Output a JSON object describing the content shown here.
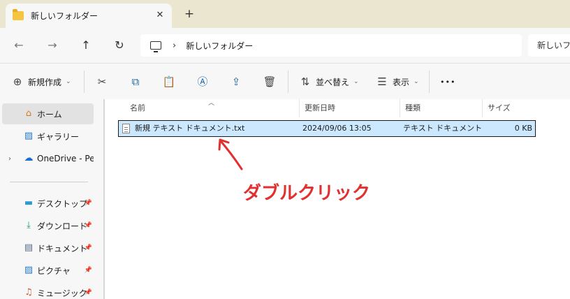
{
  "tab": {
    "title": "新しいフォルダー",
    "close": "✕",
    "new_tab": "+"
  },
  "nav": {
    "back": "←",
    "forward": "→",
    "up": "↑",
    "refresh": "↻"
  },
  "address": {
    "separator": "›",
    "crumb": "新しいフォルダー",
    "search_placeholder": "新しいフォルダー"
  },
  "commands": {
    "new_label": "新規作成",
    "sort_label": "並べ替え",
    "view_label": "表示",
    "more": "•••"
  },
  "sidebar": {
    "items": [
      {
        "label": "ホーム"
      },
      {
        "label": "ギャラリー"
      },
      {
        "label": "OneDrive - Pers"
      },
      {
        "label": "デスクトップ"
      },
      {
        "label": "ダウンロード"
      },
      {
        "label": "ドキュメント"
      },
      {
        "label": "ピクチャ"
      },
      {
        "label": "ミュージック"
      }
    ]
  },
  "columns": {
    "name": "名前",
    "date": "更新日時",
    "type": "種類",
    "size": "サイズ"
  },
  "files": [
    {
      "name": "新規 テキスト ドキュメント.txt",
      "date": "2024/09/06 13:05",
      "type": "テキスト ドキュメント",
      "size": "0 KB"
    }
  ],
  "annotation": {
    "text": "ダブルクリック",
    "color": "#e03030"
  },
  "colors": {
    "selection": "#cce8ff",
    "tabstrip": "#ebe6d0",
    "folder": "#f5c542"
  }
}
